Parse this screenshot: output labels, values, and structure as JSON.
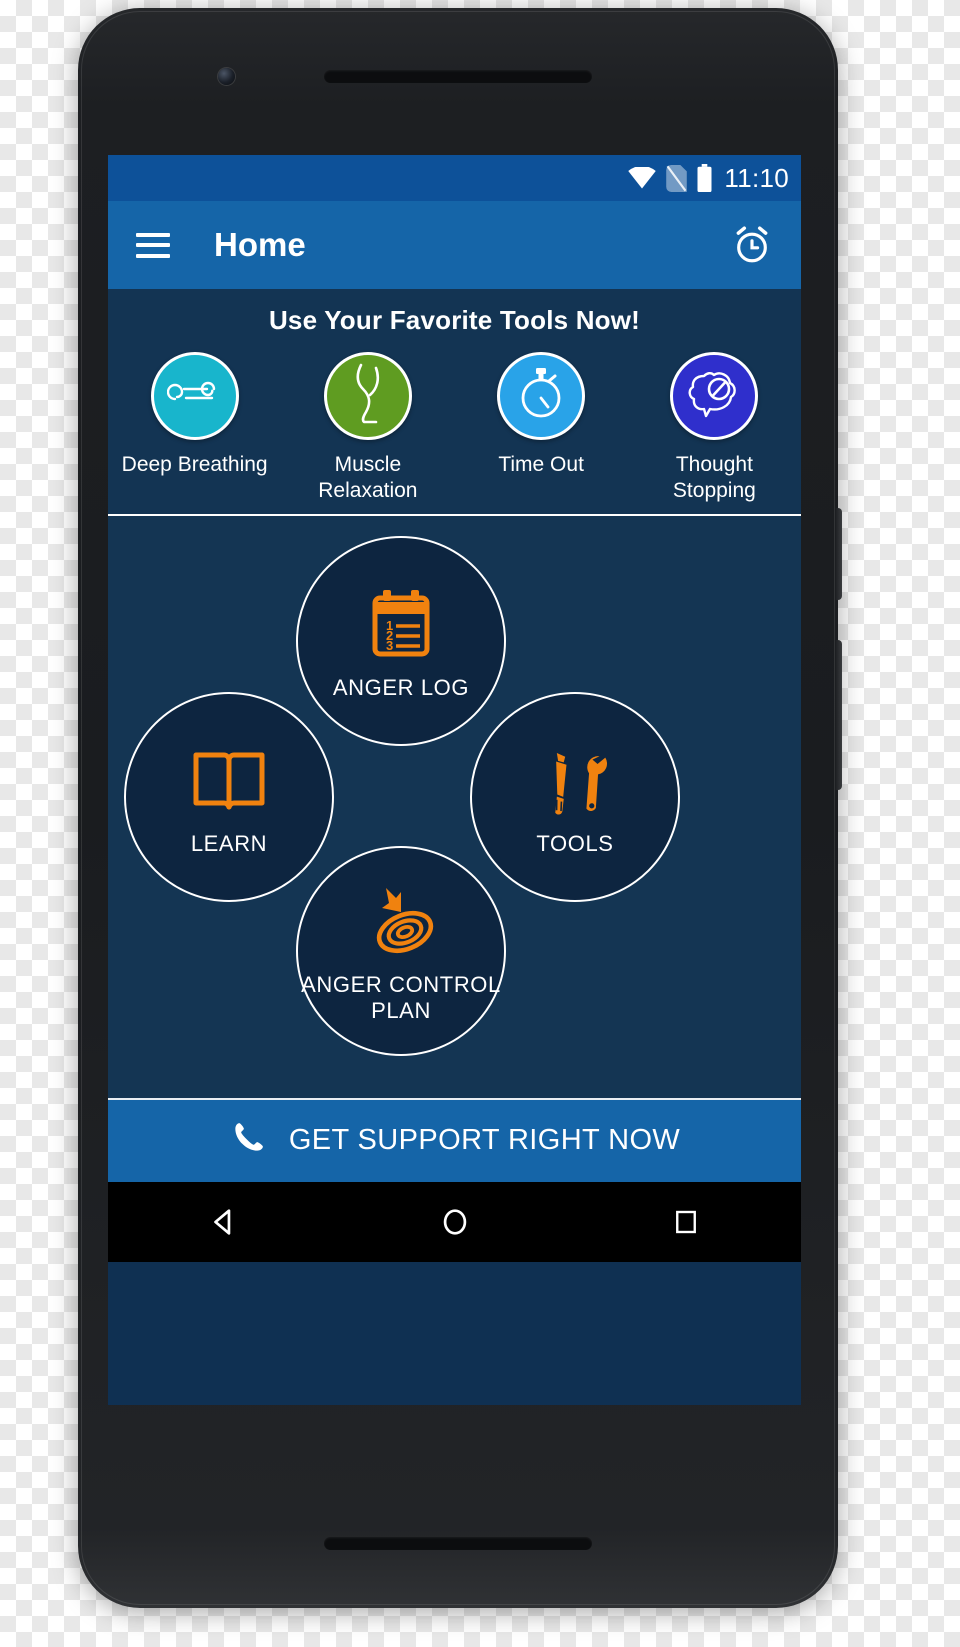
{
  "status_bar": {
    "time": "11:10",
    "icons": [
      "wifi-icon",
      "no-sim-icon",
      "battery-icon"
    ]
  },
  "app_bar": {
    "menu_icon": "hamburger-menu-icon",
    "title": "Home",
    "action_icon": "alarm-clock-icon"
  },
  "favorites": {
    "heading": "Use Your Favorite Tools Now!",
    "items": [
      {
        "label": "Deep Breathing",
        "icon": "wind-breath-icon",
        "color": "#18b5cc"
      },
      {
        "label": "Muscle Relaxation",
        "icon": "leg-muscle-icon",
        "color": "#5f9c21"
      },
      {
        "label": "Time Out",
        "icon": "stopwatch-icon",
        "color": "#29a3e8"
      },
      {
        "label": "Thought Stopping",
        "icon": "brain-no-entry-icon",
        "color": "#2f2fcc"
      }
    ]
  },
  "main": {
    "circles": [
      {
        "label": "ANGER LOG",
        "icon": "clipboard-numbered-list-icon"
      },
      {
        "label": "LEARN",
        "icon": "open-book-icon"
      },
      {
        "label": "TOOLS",
        "icon": "screwdriver-wrench-icon"
      },
      {
        "label": "ANGER CONTROL PLAN",
        "icon": "target-dart-icon"
      }
    ],
    "accent_color": "#f0820f",
    "circle_fill": "#0d2540",
    "background": "#143553"
  },
  "support_bar": {
    "label": "GET SUPPORT RIGHT NOW",
    "icon": "phone-handset-icon",
    "color": "#1565a8"
  },
  "nav_bar": {
    "back": "back-triangle-icon",
    "home": "home-circle-icon",
    "recents": "recents-square-icon"
  }
}
